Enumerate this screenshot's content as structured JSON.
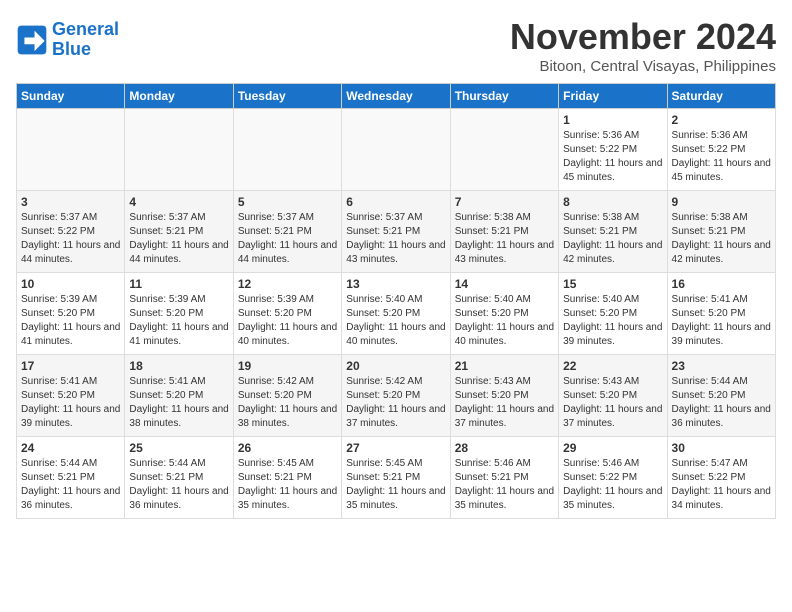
{
  "header": {
    "logo_line1": "General",
    "logo_line2": "Blue",
    "month": "November 2024",
    "location": "Bitoon, Central Visayas, Philippines"
  },
  "weekdays": [
    "Sunday",
    "Monday",
    "Tuesday",
    "Wednesday",
    "Thursday",
    "Friday",
    "Saturday"
  ],
  "weeks": [
    [
      {
        "day": "",
        "detail": ""
      },
      {
        "day": "",
        "detail": ""
      },
      {
        "day": "",
        "detail": ""
      },
      {
        "day": "",
        "detail": ""
      },
      {
        "day": "",
        "detail": ""
      },
      {
        "day": "1",
        "detail": "Sunrise: 5:36 AM\nSunset: 5:22 PM\nDaylight: 11 hours and 45 minutes."
      },
      {
        "day": "2",
        "detail": "Sunrise: 5:36 AM\nSunset: 5:22 PM\nDaylight: 11 hours and 45 minutes."
      }
    ],
    [
      {
        "day": "3",
        "detail": "Sunrise: 5:37 AM\nSunset: 5:22 PM\nDaylight: 11 hours and 44 minutes."
      },
      {
        "day": "4",
        "detail": "Sunrise: 5:37 AM\nSunset: 5:21 PM\nDaylight: 11 hours and 44 minutes."
      },
      {
        "day": "5",
        "detail": "Sunrise: 5:37 AM\nSunset: 5:21 PM\nDaylight: 11 hours and 44 minutes."
      },
      {
        "day": "6",
        "detail": "Sunrise: 5:37 AM\nSunset: 5:21 PM\nDaylight: 11 hours and 43 minutes."
      },
      {
        "day": "7",
        "detail": "Sunrise: 5:38 AM\nSunset: 5:21 PM\nDaylight: 11 hours and 43 minutes."
      },
      {
        "day": "8",
        "detail": "Sunrise: 5:38 AM\nSunset: 5:21 PM\nDaylight: 11 hours and 42 minutes."
      },
      {
        "day": "9",
        "detail": "Sunrise: 5:38 AM\nSunset: 5:21 PM\nDaylight: 11 hours and 42 minutes."
      }
    ],
    [
      {
        "day": "10",
        "detail": "Sunrise: 5:39 AM\nSunset: 5:20 PM\nDaylight: 11 hours and 41 minutes."
      },
      {
        "day": "11",
        "detail": "Sunrise: 5:39 AM\nSunset: 5:20 PM\nDaylight: 11 hours and 41 minutes."
      },
      {
        "day": "12",
        "detail": "Sunrise: 5:39 AM\nSunset: 5:20 PM\nDaylight: 11 hours and 40 minutes."
      },
      {
        "day": "13",
        "detail": "Sunrise: 5:40 AM\nSunset: 5:20 PM\nDaylight: 11 hours and 40 minutes."
      },
      {
        "day": "14",
        "detail": "Sunrise: 5:40 AM\nSunset: 5:20 PM\nDaylight: 11 hours and 40 minutes."
      },
      {
        "day": "15",
        "detail": "Sunrise: 5:40 AM\nSunset: 5:20 PM\nDaylight: 11 hours and 39 minutes."
      },
      {
        "day": "16",
        "detail": "Sunrise: 5:41 AM\nSunset: 5:20 PM\nDaylight: 11 hours and 39 minutes."
      }
    ],
    [
      {
        "day": "17",
        "detail": "Sunrise: 5:41 AM\nSunset: 5:20 PM\nDaylight: 11 hours and 39 minutes."
      },
      {
        "day": "18",
        "detail": "Sunrise: 5:41 AM\nSunset: 5:20 PM\nDaylight: 11 hours and 38 minutes."
      },
      {
        "day": "19",
        "detail": "Sunrise: 5:42 AM\nSunset: 5:20 PM\nDaylight: 11 hours and 38 minutes."
      },
      {
        "day": "20",
        "detail": "Sunrise: 5:42 AM\nSunset: 5:20 PM\nDaylight: 11 hours and 37 minutes."
      },
      {
        "day": "21",
        "detail": "Sunrise: 5:43 AM\nSunset: 5:20 PM\nDaylight: 11 hours and 37 minutes."
      },
      {
        "day": "22",
        "detail": "Sunrise: 5:43 AM\nSunset: 5:20 PM\nDaylight: 11 hours and 37 minutes."
      },
      {
        "day": "23",
        "detail": "Sunrise: 5:44 AM\nSunset: 5:20 PM\nDaylight: 11 hours and 36 minutes."
      }
    ],
    [
      {
        "day": "24",
        "detail": "Sunrise: 5:44 AM\nSunset: 5:21 PM\nDaylight: 11 hours and 36 minutes."
      },
      {
        "day": "25",
        "detail": "Sunrise: 5:44 AM\nSunset: 5:21 PM\nDaylight: 11 hours and 36 minutes."
      },
      {
        "day": "26",
        "detail": "Sunrise: 5:45 AM\nSunset: 5:21 PM\nDaylight: 11 hours and 35 minutes."
      },
      {
        "day": "27",
        "detail": "Sunrise: 5:45 AM\nSunset: 5:21 PM\nDaylight: 11 hours and 35 minutes."
      },
      {
        "day": "28",
        "detail": "Sunrise: 5:46 AM\nSunset: 5:21 PM\nDaylight: 11 hours and 35 minutes."
      },
      {
        "day": "29",
        "detail": "Sunrise: 5:46 AM\nSunset: 5:22 PM\nDaylight: 11 hours and 35 minutes."
      },
      {
        "day": "30",
        "detail": "Sunrise: 5:47 AM\nSunset: 5:22 PM\nDaylight: 11 hours and 34 minutes."
      }
    ]
  ]
}
